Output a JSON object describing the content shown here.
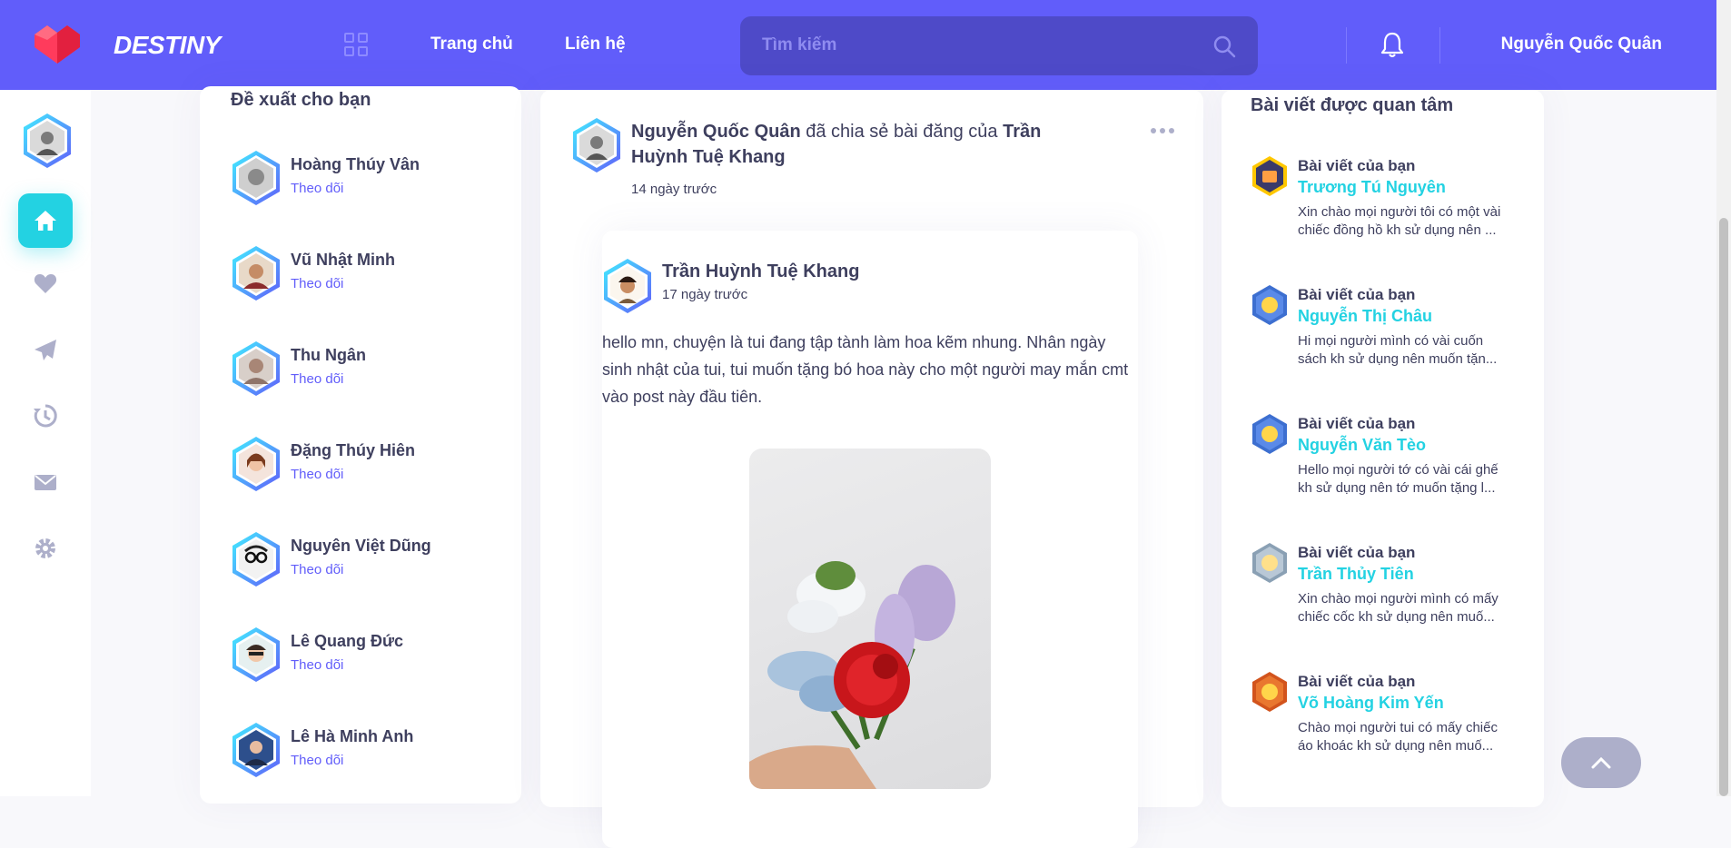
{
  "header": {
    "brand": "DESTINY",
    "nav": [
      "Trang chủ",
      "Liên hệ"
    ],
    "search_placeholder": "Tìm kiếm",
    "user_name": "Nguyễn Quốc Quân"
  },
  "suggest": {
    "title": "Đề xuất cho bạn",
    "follow_label": "Theo dõi",
    "people": [
      {
        "name": "Hoàng Thúy Vân"
      },
      {
        "name": "Vũ Nhật Minh"
      },
      {
        "name": "Thu Ngân"
      },
      {
        "name": "Đặng Thúy Hiên"
      },
      {
        "name": "Nguyên Việt Dũng"
      },
      {
        "name": "Lê Quang Đức"
      },
      {
        "name": "Lê Hà Minh Anh"
      }
    ]
  },
  "post": {
    "sharer": "Nguyễn Quốc Quân",
    "shared_text": "đã chia sẻ bài đăng của",
    "original_author": "Trần Huỳnh Tuệ Khang",
    "time": "14 ngày trước",
    "shared": {
      "author": "Trần Huỳnh Tuệ Khang",
      "time": "17 ngày trước",
      "body": "hello mn, chuyện là tui đang tập tành làm hoa kẽm nhung. Nhân ngày sinh nhật của tui, tui muốn tặng bó hoa này cho một người may mắn cmt vào post này đầu tiên."
    }
  },
  "trending": {
    "title": "Bài viết được quan tâm",
    "label": "Bài viết của bạn",
    "items": [
      {
        "name": "Trương Tú Nguyên",
        "desc": "Xin chào mọi người tôi có một vài chiếc đồng hồ kh sử dụng nên ..."
      },
      {
        "name": "Nguyễn Thị Châu",
        "desc": "Hi mọi người mình có vài cuốn sách kh sử dụng nên muốn tặn..."
      },
      {
        "name": "Nguyễn Văn Tèo",
        "desc": "Hello mọi người tớ có vài cái ghế kh sử dụng nên tớ muốn tặng l..."
      },
      {
        "name": "Trần Thủy Tiên",
        "desc": "Xin chào mọi người mình có mấy chiếc cốc kh sử dụng nên muố..."
      },
      {
        "name": "Võ Hoàng Kim Yến",
        "desc": "Chào mọi người tui có mấy chiếc áo khoác kh sử dụng nên muố..."
      }
    ]
  },
  "colors": {
    "primary": "#615dfa",
    "accent": "#23d2e2"
  },
  "icons": {
    "sidebar": [
      "home-icon",
      "heart-icon",
      "send-icon",
      "history-icon",
      "mail-icon",
      "gear-icon"
    ]
  }
}
